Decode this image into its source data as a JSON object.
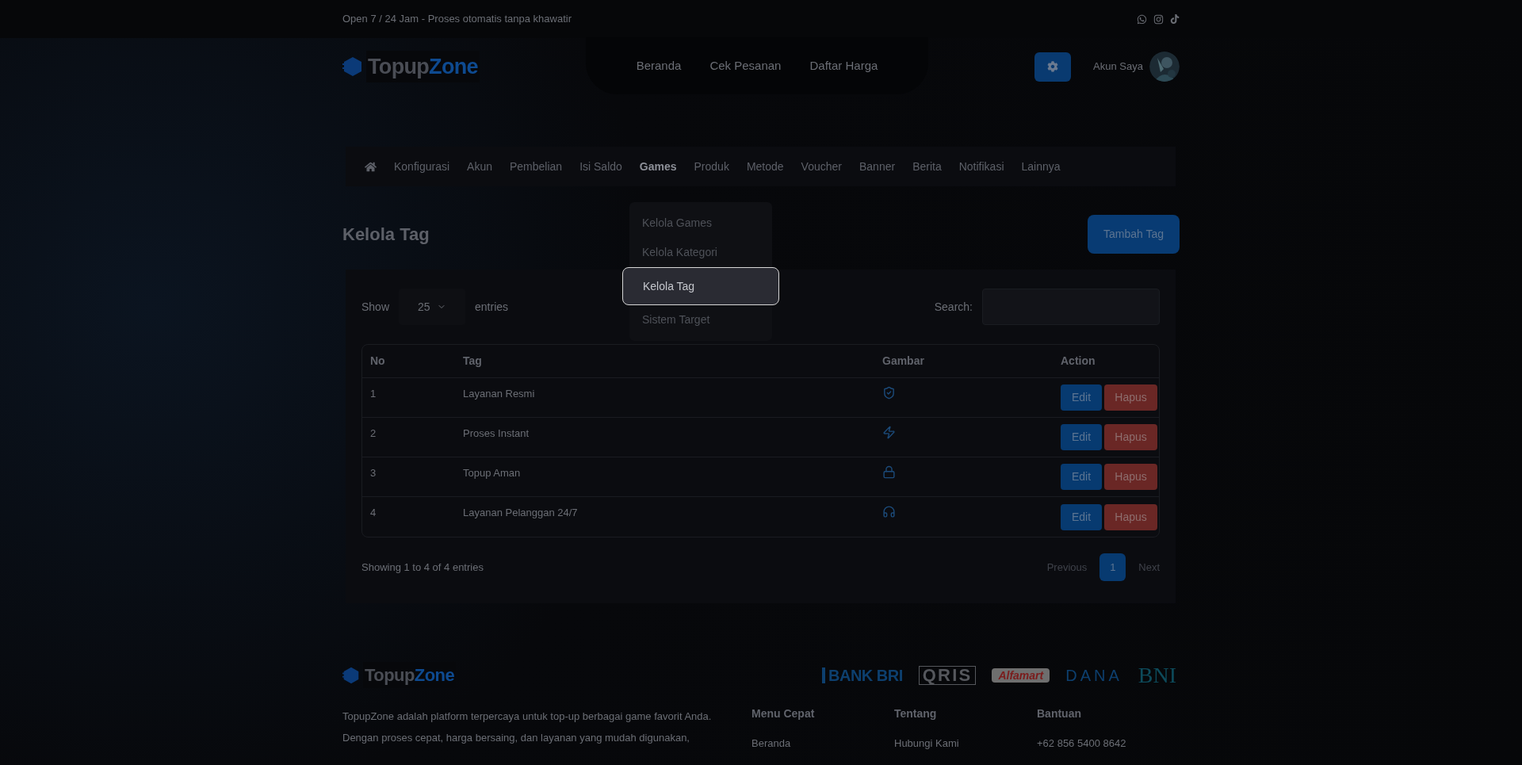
{
  "top_bar": {
    "text": "Open 7 / 24 Jam - Proses otomatis tanpa khawatir"
  },
  "brand": {
    "first": "Topup",
    "second": "Zone"
  },
  "header": {
    "links": [
      "Beranda",
      "Cek Pesanan",
      "Daftar Harga"
    ],
    "account": "Akun Saya"
  },
  "admin_nav": [
    {
      "label": "Konfigurasi",
      "selected": false
    },
    {
      "label": "Akun",
      "selected": false
    },
    {
      "label": "Pembelian",
      "selected": false
    },
    {
      "label": "Isi Saldo",
      "selected": false
    },
    {
      "label": "Games",
      "selected": true
    },
    {
      "label": "Produk",
      "selected": false
    },
    {
      "label": "Metode",
      "selected": false
    },
    {
      "label": "Voucher",
      "selected": false
    },
    {
      "label": "Banner",
      "selected": false
    },
    {
      "label": "Berita",
      "selected": false
    },
    {
      "label": "Notifikasi",
      "selected": false
    },
    {
      "label": "Lainnya",
      "selected": false
    }
  ],
  "dropdown": [
    {
      "label": "Kelola Games",
      "selected": false
    },
    {
      "label": "Kelola Kategori",
      "selected": false
    },
    {
      "label": "Kelola Tag",
      "selected": true
    },
    {
      "label": "Sistem Target",
      "selected": false
    }
  ],
  "page": {
    "title": "Kelola Tag",
    "add_button": "Tambah Tag"
  },
  "table_controls": {
    "show": "Show",
    "page_size": "25",
    "entries": "entries",
    "search": "Search:"
  },
  "table": {
    "columns": [
      "No",
      "Tag",
      "Gambar",
      "Action"
    ],
    "rows": [
      {
        "no": "1",
        "tag": "Layanan Resmi",
        "edit": "Edit",
        "delete": "Hapus"
      },
      {
        "no": "2",
        "tag": "Proses Instant",
        "edit": "Edit",
        "delete": "Hapus"
      },
      {
        "no": "3",
        "tag": "Topup Aman",
        "edit": "Edit",
        "delete": "Hapus"
      },
      {
        "no": "4",
        "tag": "Layanan Pelanggan 24/7",
        "edit": "Edit",
        "delete": "Hapus"
      }
    ]
  },
  "table_footer": {
    "info": "Showing 1 to 4 of 4 entries",
    "pagination": [
      {
        "label": "Previous",
        "selected": false
      },
      {
        "label": "1",
        "selected": true
      },
      {
        "label": "Next",
        "selected": false
      }
    ]
  },
  "footer": {
    "brand": {
      "first": "Topup",
      "second": "Zone"
    },
    "payment_logos": [
      "BANK BRI",
      "QRIS",
      "Alfamart",
      "DANA",
      "BNI"
    ],
    "about": "TopupZone adalah platform terpercaya untuk top-up berbagai game favorit Anda. Dengan proses cepat, harga bersaing, dan layanan yang mudah digunakan,",
    "columns": [
      {
        "title": "Menu Cepat",
        "links": [
          "Beranda"
        ]
      },
      {
        "title": "Tentang",
        "links": [
          "Hubungi Kami"
        ]
      },
      {
        "title": "Bantuan",
        "links": [
          "+62 856 5400 8642"
        ]
      }
    ]
  }
}
